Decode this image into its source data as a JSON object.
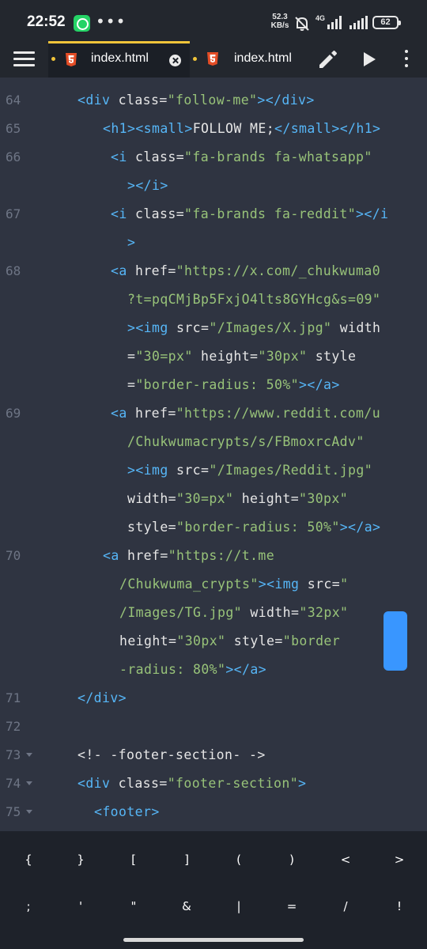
{
  "status_bar": {
    "time": "22:52",
    "net_speed_value": "52.3",
    "net_speed_unit": "KB/s",
    "network_type": "4G",
    "battery_level": "62",
    "overflow": "•••",
    "notification_app_icon": "whatsapp-icon"
  },
  "toolbar": {
    "tabs": [
      {
        "label": "index.html",
        "active": true,
        "unsaved": true,
        "icon": "html5-icon"
      },
      {
        "label": "index.html",
        "active": false,
        "unsaved": true,
        "icon": "html5-icon"
      }
    ],
    "actions": [
      "pencil-icon",
      "play-icon",
      "more-vertical-icon"
    ],
    "accent_color": "#f0c43a"
  },
  "editor": {
    "scrollbar_color": "#3996ff",
    "lines": [
      {
        "num": "64",
        "segments": [
          {
            "t": "<div ",
            "c": "tg"
          },
          {
            "t": "class",
            "c": "at"
          },
          {
            "t": "=",
            "c": "tx"
          },
          {
            "t": "\"follow-me\"",
            "c": "st"
          },
          {
            "t": "></div>",
            "c": "tg"
          }
        ]
      },
      {
        "num": "65",
        "segments": [
          {
            "t": "<h1><small>",
            "c": "tg"
          },
          {
            "t": "FOLLOW ME;",
            "c": "tx"
          },
          {
            "t": "</small></h1>",
            "c": "tg"
          }
        ]
      },
      {
        "num": "66",
        "segments": [
          {
            "t": "<i ",
            "c": "tg"
          },
          {
            "t": "class",
            "c": "at"
          },
          {
            "t": "=",
            "c": "tx"
          },
          {
            "t": "\"fa-brands fa-whatsapp\"",
            "c": "st"
          }
        ]
      },
      {
        "num": "",
        "segments": [
          {
            "t": "></i>",
            "c": "tg"
          }
        ]
      },
      {
        "num": "67",
        "segments": [
          {
            "t": "<i ",
            "c": "tg"
          },
          {
            "t": "class",
            "c": "at"
          },
          {
            "t": "=",
            "c": "tx"
          },
          {
            "t": "\"fa-brands fa-reddit\"",
            "c": "st"
          },
          {
            "t": "></i",
            "c": "tg"
          }
        ]
      },
      {
        "num": "",
        "segments": [
          {
            "t": ">",
            "c": "tg"
          }
        ]
      },
      {
        "num": "68",
        "segments": [
          {
            "t": "<a ",
            "c": "tg"
          },
          {
            "t": "href",
            "c": "at"
          },
          {
            "t": "=",
            "c": "tx"
          },
          {
            "t": "\"https://x.com/_chukwuma0",
            "c": "st"
          }
        ]
      },
      {
        "num": "",
        "segments": [
          {
            "t": "?t=pqCMjBp5FxjO4lts8GYHcg&s=09\"",
            "c": "st"
          }
        ]
      },
      {
        "num": "",
        "segments": [
          {
            "t": "><img ",
            "c": "tg"
          },
          {
            "t": "src",
            "c": "at"
          },
          {
            "t": "=",
            "c": "tx"
          },
          {
            "t": "\"/Images/X.jpg\"",
            "c": "st"
          },
          {
            "t": " width",
            "c": "at"
          }
        ]
      },
      {
        "num": "",
        "segments": [
          {
            "t": "=",
            "c": "tx"
          },
          {
            "t": "\"30=px\"",
            "c": "st"
          },
          {
            "t": " height",
            "c": "at"
          },
          {
            "t": "=",
            "c": "tx"
          },
          {
            "t": "\"30px\"",
            "c": "st"
          },
          {
            "t": " style",
            "c": "at"
          }
        ]
      },
      {
        "num": "",
        "segments": [
          {
            "t": "=",
            "c": "tx"
          },
          {
            "t": "\"border-radius: 50%\"",
            "c": "st"
          },
          {
            "t": "></a>",
            "c": "tg"
          }
        ]
      },
      {
        "num": "69",
        "segments": [
          {
            "t": "<a ",
            "c": "tg"
          },
          {
            "t": "href",
            "c": "at"
          },
          {
            "t": "=",
            "c": "tx"
          },
          {
            "t": "\"https://www.reddit.com/u",
            "c": "st"
          }
        ]
      },
      {
        "num": "",
        "segments": [
          {
            "t": "/Chukwumacrypts/s/FBmoxrcAdv\"",
            "c": "st"
          }
        ]
      },
      {
        "num": "",
        "segments": [
          {
            "t": "><img ",
            "c": "tg"
          },
          {
            "t": "src",
            "c": "at"
          },
          {
            "t": "=",
            "c": "tx"
          },
          {
            "t": "\"/Images/Reddit.jpg\"",
            "c": "st"
          }
        ]
      },
      {
        "num": "",
        "segments": [
          {
            "t": "width",
            "c": "at"
          },
          {
            "t": "=",
            "c": "tx"
          },
          {
            "t": "\"30=px\"",
            "c": "st"
          },
          {
            "t": " height",
            "c": "at"
          },
          {
            "t": "=",
            "c": "tx"
          },
          {
            "t": "\"30px\"",
            "c": "st"
          }
        ]
      },
      {
        "num": "",
        "segments": [
          {
            "t": "style",
            "c": "at"
          },
          {
            "t": "=",
            "c": "tx"
          },
          {
            "t": "\"border-radius: 50%\"",
            "c": "st"
          },
          {
            "t": "></a>",
            "c": "tg"
          }
        ]
      },
      {
        "num": "70",
        "segments": [
          {
            "t": "<a ",
            "c": "tg"
          },
          {
            "t": "href",
            "c": "at"
          },
          {
            "t": "=",
            "c": "tx"
          },
          {
            "t": "\"https://t.me",
            "c": "st"
          }
        ]
      },
      {
        "num": "",
        "segments": [
          {
            "t": "/Chukwuma_crypts\"",
            "c": "st"
          },
          {
            "t": "><img ",
            "c": "tg"
          },
          {
            "t": "src",
            "c": "at"
          },
          {
            "t": "=",
            "c": "tx"
          },
          {
            "t": "\"",
            "c": "st"
          }
        ]
      },
      {
        "num": "",
        "segments": [
          {
            "t": "/Images/TG.jpg\"",
            "c": "st"
          },
          {
            "t": " width",
            "c": "at"
          },
          {
            "t": "=",
            "c": "tx"
          },
          {
            "t": "\"32px\"",
            "c": "st"
          }
        ]
      },
      {
        "num": "",
        "segments": [
          {
            "t": "height",
            "c": "at"
          },
          {
            "t": "=",
            "c": "tx"
          },
          {
            "t": "\"30px\"",
            "c": "st"
          },
          {
            "t": " style",
            "c": "at"
          },
          {
            "t": "=",
            "c": "tx"
          },
          {
            "t": "\"border",
            "c": "st"
          }
        ]
      },
      {
        "num": "",
        "segments": [
          {
            "t": "-radius: 80%\"",
            "c": "st"
          },
          {
            "t": "></a>",
            "c": "tg"
          }
        ]
      },
      {
        "num": "71",
        "segments": [
          {
            "t": "</div>",
            "c": "tg"
          }
        ]
      },
      {
        "num": "72",
        "segments": []
      },
      {
        "num": "73",
        "fold": true,
        "segments": [
          {
            "t": "<!- -footer-section- ->",
            "c": "cm"
          }
        ]
      },
      {
        "num": "74",
        "fold": true,
        "segments": [
          {
            "t": "<div ",
            "c": "tg"
          },
          {
            "t": "class",
            "c": "at"
          },
          {
            "t": "=",
            "c": "tx"
          },
          {
            "t": "\"footer-section\"",
            "c": "st"
          },
          {
            "t": ">",
            "c": "tg"
          }
        ]
      },
      {
        "num": "75",
        "fold": true,
        "segments": [
          {
            "t": "<footer>",
            "c": "tg"
          }
        ]
      }
    ]
  },
  "symbol_bar": {
    "row1": [
      "{",
      "}",
      "[",
      "]",
      "(",
      ")",
      "<",
      ">"
    ],
    "row2": [
      ";",
      "'",
      "\"",
      "&",
      "|",
      "=",
      "/",
      "!"
    ]
  }
}
